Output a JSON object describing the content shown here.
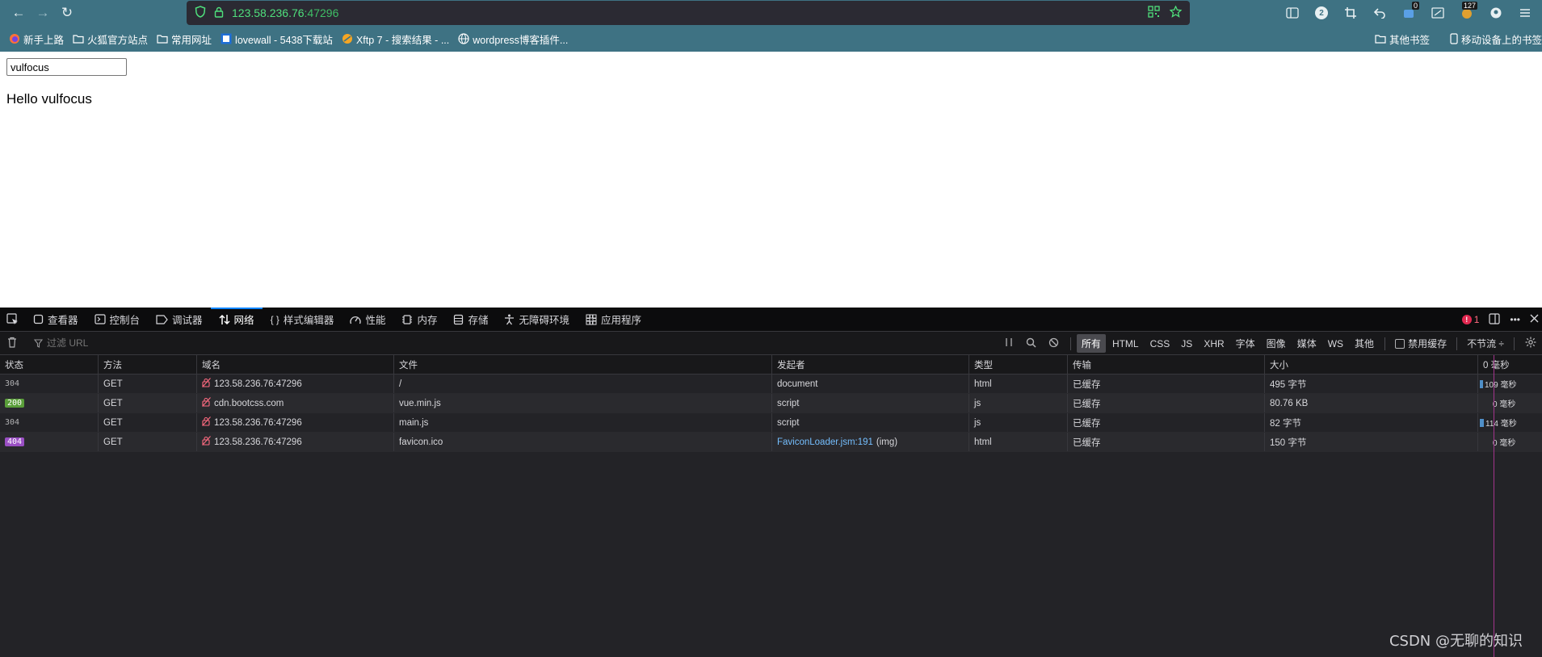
{
  "navbar": {
    "back_icon": "←",
    "forward_icon": "→",
    "reload_icon": "↻",
    "url_host": "123.58.236.76",
    "url_port": ":47296",
    "toolbar_badges": {
      "ext_two": "2",
      "ext_zero": "0",
      "ext_127": "127"
    }
  },
  "bookmarks": {
    "items": [
      {
        "label": "新手上路",
        "icon": "firefox-icon"
      },
      {
        "label": "火狐官方站点",
        "icon": "folder-icon"
      },
      {
        "label": "常用网址",
        "icon": "folder-icon"
      },
      {
        "label": "lovewall - 5438下载站",
        "icon": "site-icon"
      },
      {
        "label": "Xftp 7 - 搜索结果 - ...",
        "icon": "xftp-icon"
      },
      {
        "label": "wordpress博客插件...",
        "icon": "globe-icon"
      }
    ],
    "other": "其他书签",
    "mobile": "移动设备上的书签"
  },
  "page": {
    "input_value": "vulfocus",
    "greeting": "Hello vulfocus"
  },
  "devtools": {
    "tabs": [
      {
        "label": "查看器",
        "icon": "inspector-icon"
      },
      {
        "label": "控制台",
        "icon": "console-icon"
      },
      {
        "label": "调试器",
        "icon": "debugger-icon"
      },
      {
        "label": "网络",
        "icon": "network-icon",
        "active": true
      },
      {
        "label": "样式编辑器",
        "icon": "style-editor-icon"
      },
      {
        "label": "性能",
        "icon": "performance-icon"
      },
      {
        "label": "内存",
        "icon": "memory-icon"
      },
      {
        "label": "存储",
        "icon": "storage-icon"
      },
      {
        "label": "无障碍环境",
        "icon": "accessibility-icon"
      },
      {
        "label": "应用程序",
        "icon": "application-icon"
      }
    ],
    "error_count": "1",
    "filter_placeholder": "过滤 URL",
    "type_filters": [
      "所有",
      "HTML",
      "CSS",
      "JS",
      "XHR",
      "字体",
      "图像",
      "媒体",
      "WS",
      "其他"
    ],
    "disable_cache": "禁用缓存",
    "throttle": "不节流 ÷",
    "columns": [
      "状态",
      "方法",
      "域名",
      "文件",
      "发起者",
      "类型",
      "传输",
      "大小",
      "0 毫秒"
    ],
    "rows": [
      {
        "status": "304",
        "status_style": "plain",
        "method": "GET",
        "domain": "123.58.236.76:47296",
        "file": "/",
        "initiator": "document",
        "initiator_link": false,
        "initiator_extra": "",
        "type": "html",
        "transfer": "已缓存",
        "size": "495 字节",
        "timing": "109 毫秒",
        "wf_fraction": 0.05
      },
      {
        "status": "200",
        "status_style": "ok",
        "method": "GET",
        "domain": "cdn.bootcss.com",
        "file": "vue.min.js",
        "initiator": "script",
        "initiator_link": false,
        "initiator_extra": "",
        "type": "js",
        "transfer": "已缓存",
        "size": "80.76 KB",
        "timing": "0 毫秒",
        "wf_fraction": 0
      },
      {
        "status": "304",
        "status_style": "plain",
        "method": "GET",
        "domain": "123.58.236.76:47296",
        "file": "main.js",
        "initiator": "script",
        "initiator_link": false,
        "initiator_extra": "",
        "type": "js",
        "transfer": "已缓存",
        "size": "82 字节",
        "timing": "114 毫秒",
        "wf_fraction": 0.06
      },
      {
        "status": "404",
        "status_style": "err",
        "method": "GET",
        "domain": "123.58.236.76:47296",
        "file": "favicon.ico",
        "initiator": "FaviconLoader.jsm:191",
        "initiator_link": true,
        "initiator_extra": "(img)",
        "type": "html",
        "transfer": "已缓存",
        "size": "150 字节",
        "timing": "0 毫秒",
        "wf_fraction": 0
      }
    ]
  },
  "colors": {
    "accent": "#0a84ff",
    "status_ok": "#5a9e3a",
    "status_err": "#9a4fc4",
    "url_green": "#4fe07c",
    "chrome_teal": "#3e7283"
  },
  "watermark": "CSDN @无聊的知识"
}
